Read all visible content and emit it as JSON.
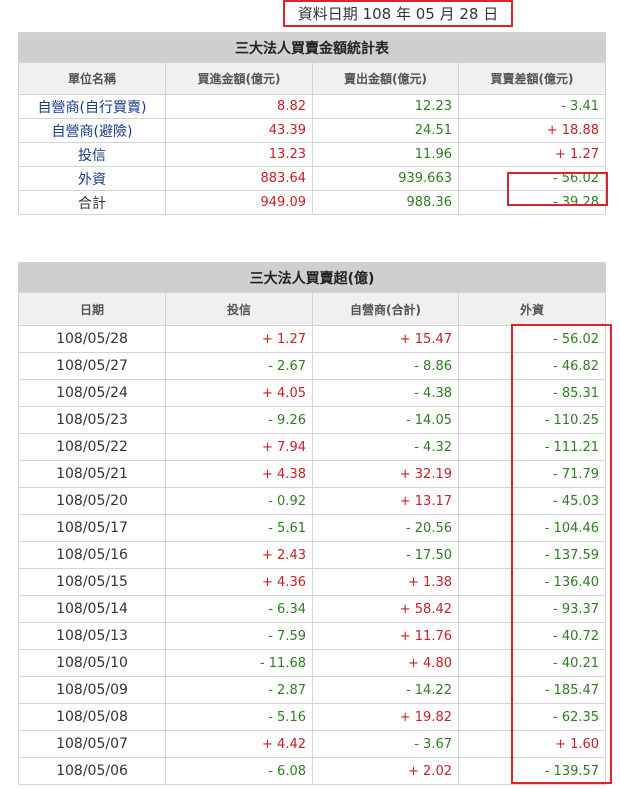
{
  "date_label": "資料日期 108 年 05 月 28 日",
  "summary": {
    "title": "三大法人買賣金額統計表",
    "headers": [
      "單位名稱",
      "買進金額(億元)",
      "賣出金額(億元)",
      "買賣差額(億元)"
    ],
    "rows": [
      {
        "name": "自營商(自行買賣)",
        "buy": "8.82",
        "sell": "12.23",
        "diff": "- 3.41"
      },
      {
        "name": "自營商(避險)",
        "buy": "43.39",
        "sell": "24.51",
        "diff": "+ 18.88"
      },
      {
        "name": "投信",
        "buy": "13.23",
        "sell": "11.96",
        "diff": "+ 1.27"
      },
      {
        "name": "外資",
        "buy": "883.64",
        "sell": "939.663",
        "diff": "- 56.02"
      },
      {
        "name": "合計",
        "buy": "949.09",
        "sell": "988.36",
        "diff": "- 39.28"
      }
    ]
  },
  "daily": {
    "title": "三大法人買賣超(億)",
    "headers": [
      "日期",
      "投信",
      "自營商(合計)",
      "外資"
    ],
    "rows": [
      {
        "date": "108/05/28",
        "trust": "+ 1.27",
        "dealer": "+ 15.47",
        "foreign": "- 56.02"
      },
      {
        "date": "108/05/27",
        "trust": "- 2.67",
        "dealer": "- 8.86",
        "foreign": "- 46.82"
      },
      {
        "date": "108/05/24",
        "trust": "+ 4.05",
        "dealer": "- 4.38",
        "foreign": "- 85.31"
      },
      {
        "date": "108/05/23",
        "trust": "- 9.26",
        "dealer": "- 14.05",
        "foreign": "- 110.25"
      },
      {
        "date": "108/05/22",
        "trust": "+ 7.94",
        "dealer": "- 4.32",
        "foreign": "- 111.21"
      },
      {
        "date": "108/05/21",
        "trust": "+ 4.38",
        "dealer": "+ 32.19",
        "foreign": "- 71.79"
      },
      {
        "date": "108/05/20",
        "trust": "- 0.92",
        "dealer": "+ 13.17",
        "foreign": "- 45.03"
      },
      {
        "date": "108/05/17",
        "trust": "- 5.61",
        "dealer": "- 20.56",
        "foreign": "- 104.46"
      },
      {
        "date": "108/05/16",
        "trust": "+ 2.43",
        "dealer": "- 17.50",
        "foreign": "- 137.59"
      },
      {
        "date": "108/05/15",
        "trust": "+ 4.36",
        "dealer": "+ 1.38",
        "foreign": "- 136.40"
      },
      {
        "date": "108/05/14",
        "trust": "- 6.34",
        "dealer": "+ 58.42",
        "foreign": "- 93.37"
      },
      {
        "date": "108/05/13",
        "trust": "- 7.59",
        "dealer": "+ 11.76",
        "foreign": "- 40.72"
      },
      {
        "date": "108/05/10",
        "trust": "- 11.68",
        "dealer": "+ 4.80",
        "foreign": "- 40.21"
      },
      {
        "date": "108/05/09",
        "trust": "- 2.87",
        "dealer": "- 14.22",
        "foreign": "- 185.47"
      },
      {
        "date": "108/05/08",
        "trust": "- 5.16",
        "dealer": "+ 19.82",
        "foreign": "- 62.35"
      },
      {
        "date": "108/05/07",
        "trust": "+ 4.42",
        "dealer": "- 3.67",
        "foreign": "+ 1.60"
      },
      {
        "date": "108/05/06",
        "trust": "- 6.08",
        "dealer": "+ 2.02",
        "foreign": "- 139.57"
      }
    ]
  },
  "colors": {
    "positive": "#c81f26",
    "negative": "#2e7d22",
    "highlight": "#d9262c",
    "header_bg": "#cfcfcf"
  }
}
